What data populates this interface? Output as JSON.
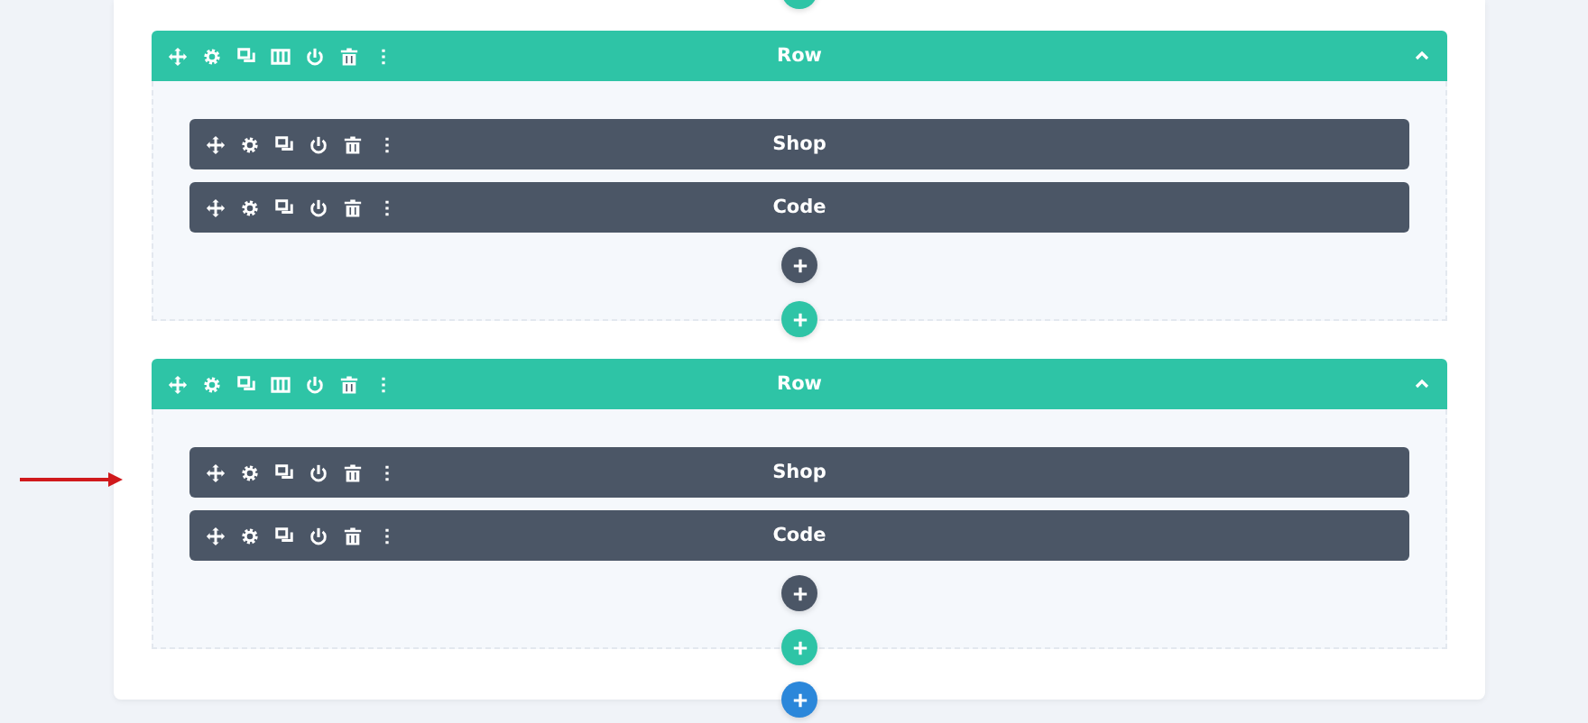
{
  "rows": [
    {
      "label": "Row",
      "expanded": true,
      "modules": [
        {
          "label": "Shop"
        },
        {
          "label": "Code"
        }
      ]
    },
    {
      "label": "Row",
      "expanded": true,
      "modules": [
        {
          "label": "Shop"
        },
        {
          "label": "Code"
        }
      ]
    }
  ]
}
